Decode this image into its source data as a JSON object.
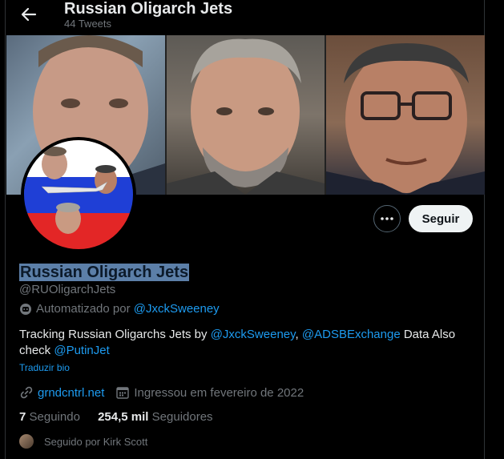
{
  "header": {
    "title": "Russian Oligarch Jets",
    "tweet_count": "44 Tweets"
  },
  "profile": {
    "display_name": "Russian Oligarch Jets",
    "handle": "@RUOligarchJets",
    "automated_prefix": "Automatizado por",
    "automated_by": "@JxckSweeney",
    "bio": {
      "part1": "Tracking Russian Oligarchs Jets by ",
      "mention1": "@JxckSweeney",
      "sep": ", ",
      "mention2": "@ADSBExchange",
      "part2": " Data Also check ",
      "mention3": "@PutinJet"
    },
    "translate_label": "Traduzir bio",
    "website": "grndcntrl.net",
    "joined": "Ingressou em fevereiro de 2022"
  },
  "stats": {
    "following_count": "7",
    "following_label": "Seguindo",
    "followers_count": "254,5 mil",
    "followers_label": "Seguidores"
  },
  "followed_by": "Seguido por Kirk Scott",
  "actions": {
    "follow_label": "Seguir"
  },
  "colors": {
    "background": "#000000",
    "accent": "#1d9bf0",
    "text": "#e7e9ea",
    "muted": "#71767b",
    "selection": "#5c7fa8"
  },
  "icons": [
    "back-arrow-icon",
    "more-icon",
    "bot-icon",
    "link-icon",
    "calendar-icon"
  ]
}
